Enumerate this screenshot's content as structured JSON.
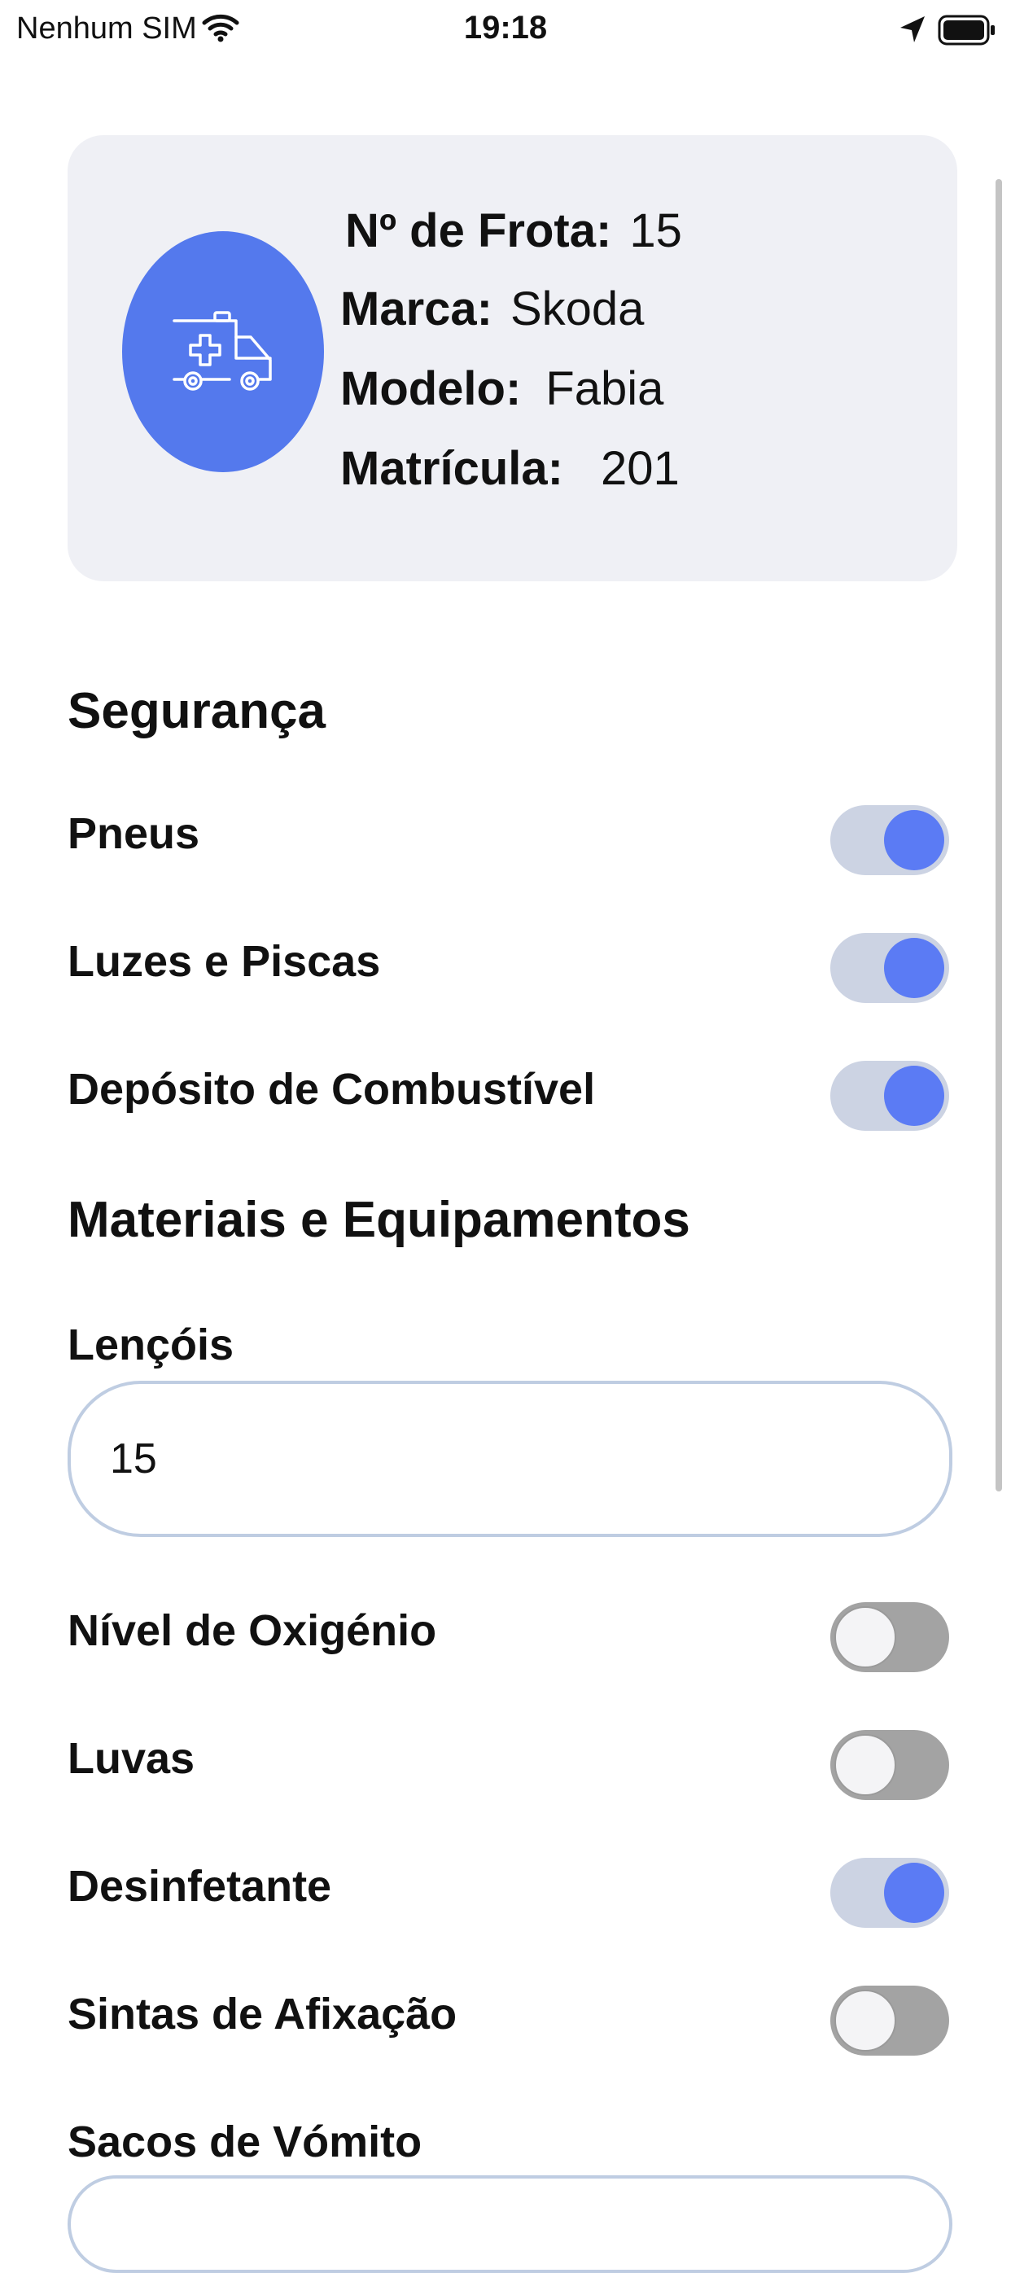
{
  "status_bar": {
    "carrier": "Nenhum SIM",
    "time": "19:18"
  },
  "vehicle": {
    "icon": "ambulance-icon",
    "fleet_label": "Nº de Frota:",
    "fleet_value": "15",
    "brand_label": "Marca:",
    "brand_value": "Skoda",
    "model_label": "Modelo:",
    "model_value": "Fabia",
    "plate_label": "Matrícula:",
    "plate_value": "201"
  },
  "safety": {
    "title": "Segurança",
    "items": [
      {
        "label": "Pneus",
        "checked": true
      },
      {
        "label": "Luzes e Piscas",
        "checked": true
      },
      {
        "label": "Depósito de Combustível",
        "checked": true
      }
    ]
  },
  "materials": {
    "title": "Materiais e Equipamentos",
    "sheets_label": "Lençóis",
    "sheets_value": "15",
    "items": [
      {
        "label": "Nível de Oxigénio",
        "checked": false
      },
      {
        "label": "Luvas",
        "checked": false
      },
      {
        "label": "Desinfetante",
        "checked": true
      },
      {
        "label": "Sintas de Afixação",
        "checked": false
      }
    ],
    "vomit_bags_label": "Sacos de Vómito"
  },
  "colors": {
    "accent": "#5479ed",
    "toggle_on_knob": "#5b7bf4",
    "toggle_on_track": "#ccd3e3",
    "toggle_off_track": "#a3a3a3",
    "card_background": "#eff0f5",
    "field_border": "#bfcde2"
  }
}
